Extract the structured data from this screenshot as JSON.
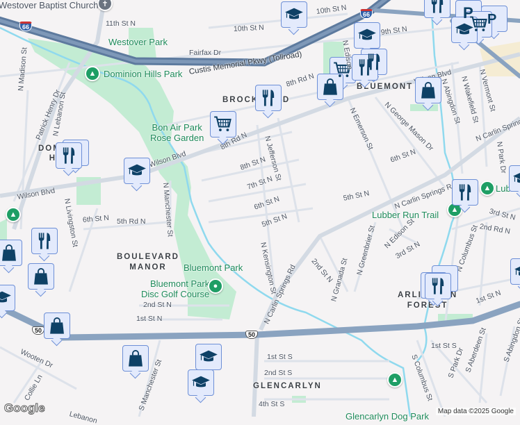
{
  "colors": {
    "park": "#c3ecd3",
    "water": "#8fd9ee",
    "highway": "#8aa3c0",
    "road": "#d9dee6",
    "marker": "#0e4166"
  },
  "parks": {
    "westover": "Westover Park",
    "dominion": "Dominion Hills Park",
    "bonair": "Bon Air Park\nRose Garden",
    "bluemont": "Bluemont Park",
    "discgolf": "Bluemont Park\nDisc Golf Course",
    "lubber": "Lubber Run Trail",
    "lubber2": "Lubber",
    "glencarlyn_dog": "Glencarlyn Dog Park"
  },
  "neighborhoods": {
    "brockwood": "BROCKWOOD",
    "bluemont": "BLUEMONT",
    "dominion": "DOMINION\nHILLS",
    "boulevard": "BOULEVARD\nMANOR",
    "arlington_forest": "ARLINGTON\nFOREST",
    "glencarlyn": "GLENCARLYN"
  },
  "poi": {
    "church": "Westover Baptist Church"
  },
  "highways": {
    "custis": "Custis Memorial Pkwy (Tollroad)",
    "i66": "66",
    "us50a": "50",
    "us50b": "50"
  },
  "streets": [
    "11th St N",
    "10th St N",
    "Fairfax Dr",
    "9th St N",
    "8th Rd N",
    "8th Rd N",
    "8th St N",
    "7th St N",
    "6th St N",
    "5th St N",
    "Wilson Blvd",
    "Wilson Blvd",
    "Wilson Blvd",
    "N Madison St",
    "Patrick Henry Dr",
    "N Lebanon St",
    "N Livingston St",
    "N Manchester St",
    "N Jefferson St",
    "N Kensington St",
    "N Carlin Springs Rd",
    "N Carlin Springs Rd",
    "N Emerson St",
    "N George Mason Dr",
    "6th St N",
    "5th St N",
    "N Abingdon St",
    "N Wakefield St",
    "N Vermont St",
    "N Park Dr",
    "3rd St N",
    "2nd Rd N",
    "N Edison St",
    "3rd St N",
    "N Greenbrier St",
    "N Granada St",
    "2nd St N",
    "N Columbus St",
    "1st St N",
    "6th St N",
    "5th Rd N",
    "2nd St N",
    "1st St N",
    "Wooten Dr",
    "Collie Ln",
    "S Manchester St",
    "1st St S",
    "2nd St S",
    "4th St S",
    "S Columbus St",
    "1st St S",
    "S Park Dr",
    "S Aberdeen St",
    "S Abingdon St",
    "Lebanon",
    "N Edison"
  ],
  "footer": {
    "logo": "Google",
    "attribution": "Map data ©2025 Google"
  }
}
